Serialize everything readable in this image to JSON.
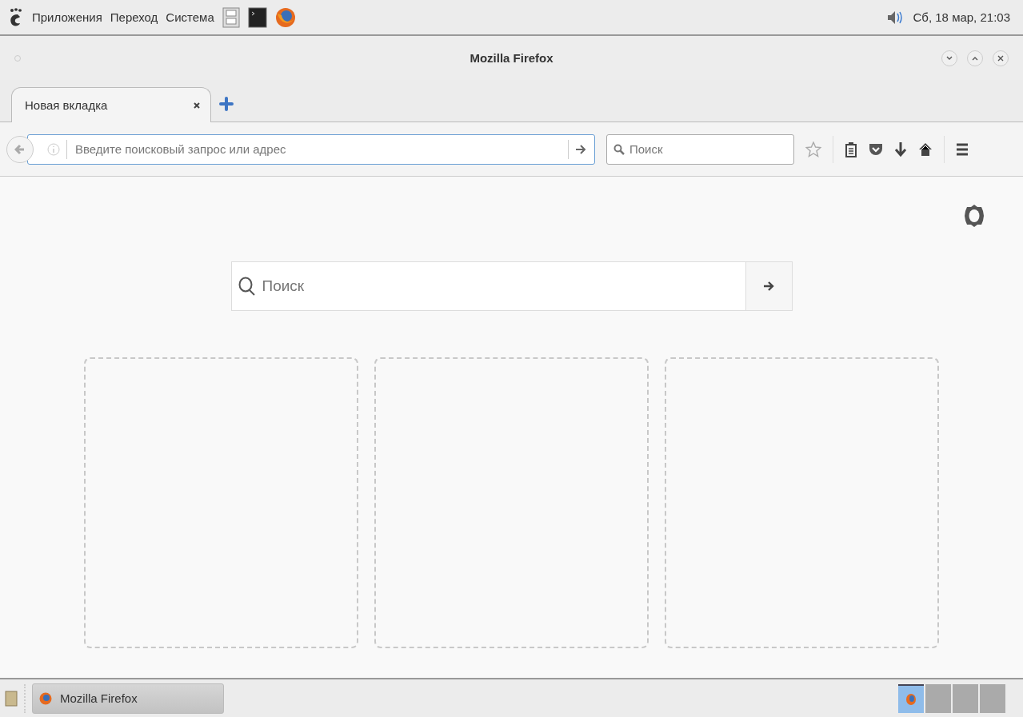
{
  "top_panel": {
    "menus": [
      "Приложения",
      "Переход",
      "Система"
    ],
    "clock": "Сб, 18 мар, 21:03"
  },
  "window": {
    "title": "Mozilla Firefox"
  },
  "tabs": [
    {
      "label": "Новая вкладка",
      "selected": true
    }
  ],
  "address_bar": {
    "placeholder": "Введите поисковый запрос или адрес"
  },
  "search_bar": {
    "placeholder": "Поиск"
  },
  "new_tab_page": {
    "search": {
      "placeholder": "Поиск"
    },
    "tiles": [
      {
        "kind": "empty"
      },
      {
        "kind": "empty"
      },
      {
        "kind": "empty"
      }
    ]
  },
  "taskbar": {
    "windows": [
      {
        "label": "Mozilla Firefox",
        "selected": false
      }
    ],
    "workspaces": [
      {
        "selected": true
      },
      {
        "selected": false
      },
      {
        "selected": false
      },
      {
        "selected": false
      }
    ]
  }
}
